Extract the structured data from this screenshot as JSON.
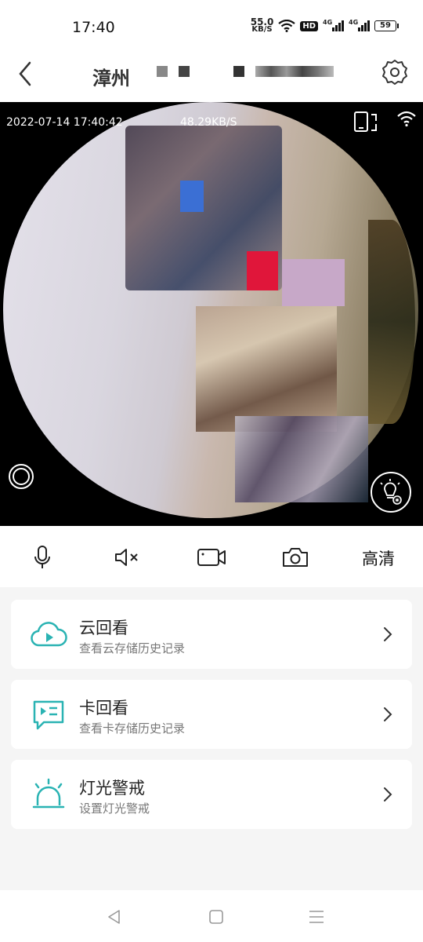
{
  "status_bar": {
    "time": "17:40",
    "net_speed_value": "55.0",
    "net_speed_unit": "KB/S",
    "hd_badge": "HD",
    "signal1_label": "4G",
    "signal2_label": "4G",
    "battery": "59"
  },
  "header": {
    "title": "漳州",
    "icons": {
      "back": "chevron-left",
      "settings": "gear"
    }
  },
  "video": {
    "timestamp": "2022-07-14 17:40:42",
    "bitrate": "48.29KB/S"
  },
  "controls": {
    "quality_label": "高清",
    "icons": [
      "microphone",
      "speaker-muted",
      "video-record",
      "camera",
      "quality"
    ]
  },
  "menu": [
    {
      "title": "云回看",
      "subtitle": "查看云存储历史记录",
      "icon": "cloud-play"
    },
    {
      "title": "卡回看",
      "subtitle": "查看卡存储历史记录",
      "icon": "sd-card-playback"
    },
    {
      "title": "灯光警戒",
      "subtitle": "设置灯光警戒",
      "icon": "alarm-light"
    }
  ],
  "colors": {
    "accent": "#2ab3b3",
    "background": "#f5f5f5"
  }
}
